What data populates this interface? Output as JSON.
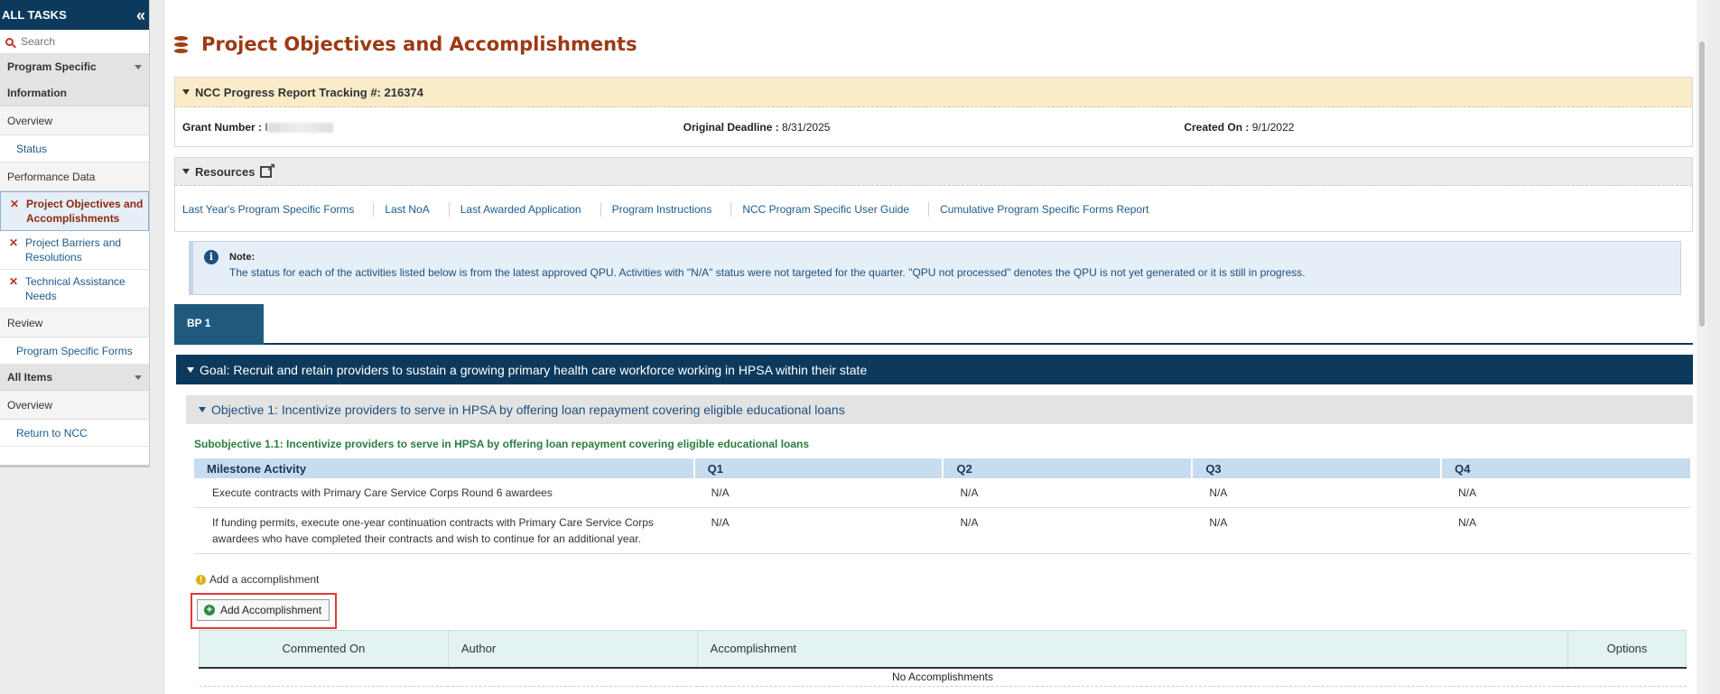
{
  "sidebar": {
    "title": "ALL TASKS",
    "collapse_icon": "double-chevron-left-icon",
    "search_placeholder": "Search",
    "group1_line1": "Program Specific",
    "group1_line2": "Information",
    "overview_label": "Overview",
    "status_label": "Status",
    "performance_label": "Performance Data",
    "items": [
      {
        "label_line1": "Project Objectives and",
        "label_line2": "Accomplishments"
      },
      {
        "label_line1": "Project Barriers and",
        "label_line2": "Resolutions"
      },
      {
        "label_line1": "Technical Assistance",
        "label_line2": "Needs"
      }
    ],
    "review_label": "Review",
    "program_forms_label": "Program Specific Forms",
    "all_items_label": "All Items",
    "overview2_label": "Overview",
    "return_label": "Return to NCC"
  },
  "page": {
    "title": "Project Objectives and Accomplishments",
    "title_icon": "database-icon"
  },
  "tracking": {
    "header": "NCC Progress Report Tracking #: 216374",
    "grant_label": "Grant Number :",
    "grant_value_prefix": "I",
    "deadline_label": "Original Deadline :",
    "deadline_value": "8/31/2025",
    "created_label": "Created On :",
    "created_value": "9/1/2022"
  },
  "resources": {
    "header": "Resources",
    "links": [
      "Last Year's Program Specific Forms",
      "Last NoA",
      "Last Awarded Application",
      "Program Instructions",
      "NCC Program Specific User Guide",
      "Cumulative Program Specific Forms Report"
    ]
  },
  "note": {
    "label": "Note:",
    "text": "The status for each of the activities listed below is from the latest approved QPU. Activities with \"N/A\" status were not targeted for the quarter. \"QPU not processed\" denotes the QPU is not yet generated or it is still in progress."
  },
  "tabs": [
    "BP 1"
  ],
  "goal": "Goal: Recruit and retain providers to sustain a growing primary health care workforce working in HPSA within their state",
  "objective": "Objective 1: Incentivize providers to serve in HPSA by offering loan repayment covering eligible educational loans",
  "subobjective": "Subobjective 1.1: Incentivize providers to serve in HPSA by offering loan repayment covering eligible educational loans",
  "milestones": {
    "headers": [
      "Milestone Activity",
      "Q1",
      "Q2",
      "Q3",
      "Q4"
    ],
    "rows": [
      {
        "activity_line1": "Execute contracts with Primary Care Service Corps Round 6 awardees",
        "activity_line2": "",
        "q1": "N/A",
        "q2": "N/A",
        "q3": "N/A",
        "q4": "N/A"
      },
      {
        "activity_line1": "If funding permits, execute one-year continuation contracts with Primary Care Service Corps",
        "activity_line2": "awardees who have completed their contracts and wish to continue for an additional year.",
        "q1": "N/A",
        "q2": "N/A",
        "q3": "N/A",
        "q4": "N/A"
      }
    ]
  },
  "accomplishment": {
    "hint": "Add a accomplishment",
    "add_button": "Add Accomplishment",
    "headers": [
      "Commented On",
      "Author",
      "Accomplishment",
      "Options"
    ],
    "empty_text": "No Accomplishments"
  },
  "colors": {
    "sidebar_header": "#0d3a5c",
    "title": "#9b3a12",
    "goal_bar": "#0d3a5c",
    "highlight_border": "#e03a3a"
  }
}
